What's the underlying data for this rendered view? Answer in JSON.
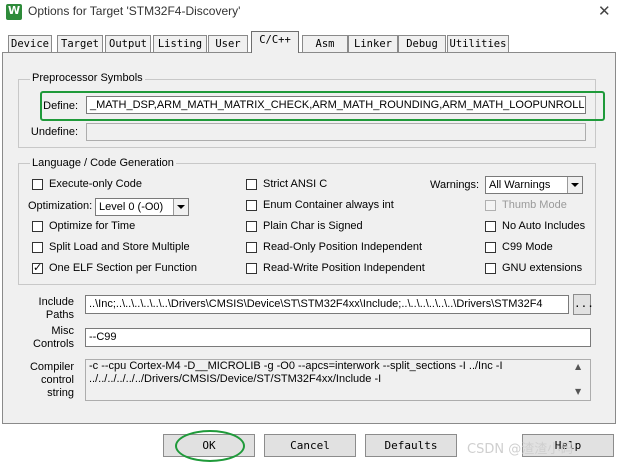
{
  "window": {
    "title": "Options for Target 'STM32F4-Discovery'",
    "close_glyph": "✕",
    "app_icon": "keil-icon"
  },
  "tabs": [
    "Device",
    "Target",
    "Output",
    "Listing",
    "User",
    "C/C++",
    "Asm",
    "Linker",
    "Debug",
    "Utilities"
  ],
  "active_tab": "C/C++",
  "preprocessor": {
    "group_title": "Preprocessor Symbols",
    "define_label": "Define:",
    "define_value": "_MATH_DSP,ARM_MATH_MATRIX_CHECK,ARM_MATH_ROUNDING,ARM_MATH_LOOPUNROLL",
    "undefine_label": "Undefine:",
    "undefine_value": ""
  },
  "language": {
    "group_title": "Language / Code Generation",
    "execute_only": {
      "label": "Execute-only Code",
      "checked": false
    },
    "optimization_label": "Optimization:",
    "optimization_value": "Level 0 (-O0)",
    "optimize_for_time": {
      "label": "Optimize for Time",
      "checked": false
    },
    "split_load_store": {
      "label": "Split Load and Store Multiple",
      "checked": false
    },
    "one_elf_section": {
      "label": "One ELF Section per Function",
      "checked": true
    },
    "strict_ansi_c": {
      "label": "Strict ANSI C",
      "checked": false
    },
    "enum_container": {
      "label": "Enum Container always int",
      "checked": false
    },
    "plain_char_signed": {
      "label": "Plain Char is Signed",
      "checked": false
    },
    "readonly_pi": {
      "label": "Read-Only Position Independent",
      "checked": false
    },
    "readwrite_pi": {
      "label": "Read-Write Position Independent",
      "checked": false
    },
    "warnings_label": "Warnings:",
    "warnings_value": "All Warnings",
    "thumb_mode": {
      "label": "Thumb Mode",
      "checked": false,
      "disabled": true
    },
    "no_auto_includes": {
      "label": "No Auto Includes",
      "checked": false
    },
    "c99_mode": {
      "label": "C99 Mode",
      "checked": false
    },
    "gnu_extensions": {
      "label": "GNU extensions",
      "checked": false
    }
  },
  "include_paths": {
    "label": "Include\nPaths",
    "label_line1": "Include",
    "label_line2": "Paths",
    "value": "..\\Inc;..\\..\\..\\..\\..\\..\\Drivers\\CMSIS\\Device\\ST\\STM32F4xx\\Include;..\\..\\..\\..\\..\\..\\Drivers\\STM32F4",
    "browse_label": "..."
  },
  "misc_controls": {
    "label_line1": "Misc",
    "label_line2": "Controls",
    "value": "--C99"
  },
  "compiler_string": {
    "label_line1": "Compiler",
    "label_line2": "control",
    "label_line3": "string",
    "line1": "-c --cpu Cortex-M4 -D__MICROLIB -g -O0 --apcs=interwork --split_sections -I ../Inc -I",
    "line2": "../../../../../../Drivers/CMSIS/Device/ST/STM32F4xx/Include -I"
  },
  "buttons": {
    "ok": "OK",
    "cancel": "Cancel",
    "defaults": "Defaults",
    "help": "Help"
  },
  "watermark": "CSDN @渣渣小码",
  "colors": {
    "highlight": "#1f9a3a",
    "dialog_bg": "#f0f0f0"
  }
}
